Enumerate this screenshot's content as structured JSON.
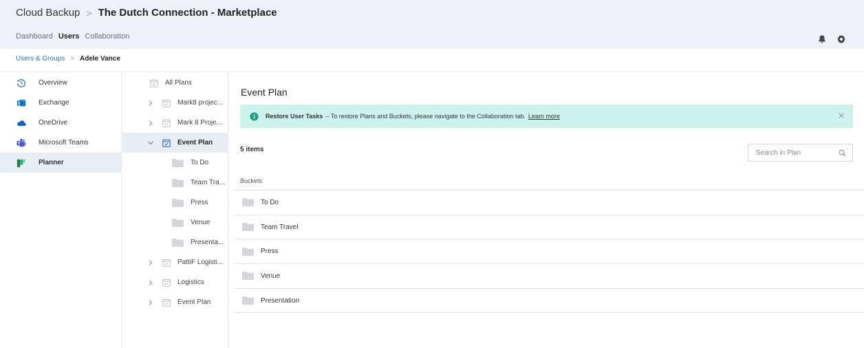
{
  "header": {
    "app_name": "Cloud Backup",
    "separator": ">",
    "tenant": "The Dutch Connection - Marketplace",
    "tabs": [
      {
        "label": "Dashboard",
        "active": false
      },
      {
        "label": "Users",
        "active": true
      },
      {
        "label": "Collaboration",
        "active": false
      }
    ],
    "icons": [
      "bell-icon",
      "gear-icon"
    ]
  },
  "breadcrumb": {
    "parent": "Users & Groups",
    "separator": ">",
    "current": "Adele Vance"
  },
  "nav": {
    "items": [
      {
        "label": "Overview",
        "icon": "history-icon",
        "active": false
      },
      {
        "label": "Exchange",
        "icon": "exchange-icon",
        "active": false
      },
      {
        "label": "OneDrive",
        "icon": "onedrive-icon",
        "active": false
      },
      {
        "label": "Microsoft Teams",
        "icon": "teams-icon",
        "active": false
      },
      {
        "label": "Planner",
        "icon": "planner-icon",
        "active": true
      }
    ]
  },
  "tree": {
    "rows": [
      {
        "label": "All Plans",
        "type": "plan",
        "level": 0,
        "chevron": "none"
      },
      {
        "label": "Mark8 projec...",
        "type": "plan",
        "level": 0,
        "chevron": "right"
      },
      {
        "label": "Mark 8 Proje...",
        "type": "plan",
        "level": 0,
        "chevron": "right"
      },
      {
        "label": "Event Plan",
        "type": "plan",
        "level": 0,
        "chevron": "down",
        "selected": true
      },
      {
        "label": "To Do",
        "type": "folder",
        "level": 1
      },
      {
        "label": "Team Tra...",
        "type": "folder",
        "level": 1
      },
      {
        "label": "Press",
        "type": "folder",
        "level": 1
      },
      {
        "label": "Venue",
        "type": "folder",
        "level": 1
      },
      {
        "label": "Presenta...",
        "type": "folder",
        "level": 1
      },
      {
        "label": "PattiF Logisti...",
        "type": "plan",
        "level": 0,
        "chevron": "right"
      },
      {
        "label": "Logistics",
        "type": "plan",
        "level": 0,
        "chevron": "right"
      },
      {
        "label": "Event Plan",
        "type": "plan",
        "level": 0,
        "chevron": "right"
      }
    ]
  },
  "main": {
    "title": "Event Plan",
    "banner": {
      "strong": "Restore User Tasks",
      "text": "– To restore Plans and Buckets, please navigate to the Collaboration tab.",
      "link": "Learn more"
    },
    "count": "5 items",
    "search_placeholder": "Search in Plan",
    "column_header": "Buckets",
    "rows": [
      "To Do",
      "Team Travel",
      "Press",
      "Venue",
      "Presentation"
    ]
  },
  "colors": {
    "header_bg": "#eef1f5",
    "selected_bg": "#e8eef6",
    "banner_bg": "#cdf3ed",
    "info_icon": "#1e9e86",
    "link": "#2f6fc4",
    "plan_icon": "#b9c0c8",
    "folder": "#d3d7dc"
  }
}
